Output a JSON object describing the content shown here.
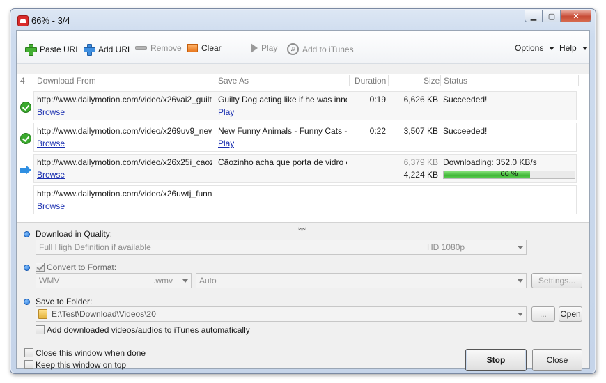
{
  "window": {
    "title": "66% - 3/4"
  },
  "toolbar": {
    "paste_url": "Paste URL",
    "add_url": "Add URL",
    "remove": "Remove",
    "clear": "Clear",
    "play": "Play",
    "add_to_itunes": "Add to iTunes",
    "options": "Options",
    "help": "Help"
  },
  "list": {
    "count": "4",
    "headers": {
      "download_from": "Download From",
      "save_as": "Save As",
      "duration": "Duration",
      "size": "Size",
      "status": "Status"
    },
    "rows": [
      {
        "state": "succeeded",
        "url": "http://www.dailymotion.com/video/x26vai2_guilt...",
        "browse": "Browse",
        "save_as": "Guilty Dog acting like if he was inno...",
        "play": "Play",
        "duration": "0:19",
        "size": "6,626 KB",
        "status": "Succeeded!"
      },
      {
        "state": "succeeded",
        "url": "http://www.dailymotion.com/video/x269uv9_new...",
        "browse": "Browse",
        "save_as": "New Funny Animals - Funny Cats - ...",
        "play": "Play",
        "duration": "0:22",
        "size": "3,507 KB",
        "status": "Succeeded!"
      },
      {
        "state": "downloading",
        "url": "http://www.dailymotion.com/video/x26x25i_caozi...",
        "browse": "Browse",
        "save_as": "Cãozinho acha que porta de vidro e...",
        "size_total": "6,379 KB",
        "size_done": "4,224 KB",
        "status": "Downloading: 352.0 KB/s",
        "progress": 66,
        "progress_num": "66",
        "progress_pct": "%"
      },
      {
        "state": "queued",
        "url": "http://www.dailymotion.com/video/x26uwtj_funn...",
        "browse": "Browse"
      }
    ]
  },
  "options": {
    "quality_label": "Download in Quality:",
    "quality_value": "Full High Definition if available",
    "quality_tag": "HD 1080p",
    "convert_label": "Convert to Format:",
    "format_value": "WMV",
    "format_ext": ".wmv",
    "preset_value": "Auto",
    "settings_btn": "Settings...",
    "folder_label": "Save to Folder:",
    "folder_value": "E:\\Test\\Download\\Videos\\20",
    "browse_btn": "...",
    "open_btn": "Open",
    "itunes_check": "Add downloaded videos/audios to iTunes automatically"
  },
  "footer": {
    "close_when_done": "Close this window when done",
    "keep_on_top": "Keep this window on top",
    "stop": "Stop",
    "close": "Close"
  },
  "colors": {
    "progress_green": "#3fb636",
    "link": "#1a2fb0",
    "success": "#3aa92d",
    "download_arrow": "#2f8fe2"
  },
  "icons": {
    "status_done": "check-circle-icon",
    "status_downloading": "arrow-right-icon",
    "paste": "green-plus-icon",
    "add": "blue-plus-icon",
    "remove": "minus-icon",
    "clear": "eraser-icon",
    "play": "play-icon",
    "itunes": "itunes-note-icon"
  }
}
